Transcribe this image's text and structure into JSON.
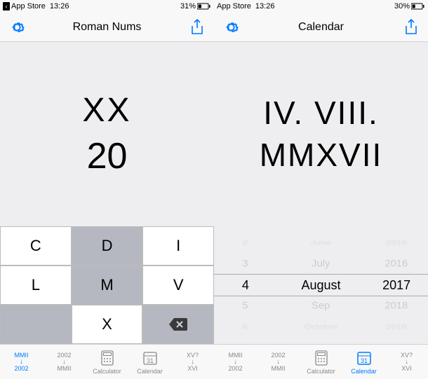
{
  "left": {
    "status": {
      "back": "‹",
      "app": "App Store",
      "time": "13:26",
      "battery": "31%"
    },
    "nav": {
      "title": "Roman Nums"
    },
    "display": {
      "roman": "XX",
      "arabic": "20"
    },
    "keyboard": {
      "rows": [
        [
          "C",
          "D",
          "I"
        ],
        [
          "L",
          "M",
          "V"
        ],
        [
          "",
          "X",
          "⌫"
        ]
      ]
    },
    "tabs": [
      {
        "top": "MMII",
        "bottom": "2002",
        "label": ""
      },
      {
        "top": "2002",
        "bottom": "MMII",
        "label": ""
      },
      {
        "label": "Calculator"
      },
      {
        "label": "Calendar"
      },
      {
        "top": "XV?",
        "bottom": "XVI",
        "label": ""
      }
    ],
    "activeTab": 0
  },
  "right": {
    "status": {
      "app": "App Store",
      "time": "13:26",
      "battery": "30%"
    },
    "nav": {
      "title": "Calendar"
    },
    "display": {
      "romanDate": "IV. VIII. MMXVII"
    },
    "picker": {
      "day": [
        "2",
        "3",
        "4",
        "5",
        "6"
      ],
      "month": [
        "June",
        "July",
        "August",
        "Sep",
        "October"
      ],
      "year": [
        "2015",
        "2016",
        "2017",
        "2018",
        "2019"
      ]
    },
    "tabs": [
      {
        "top": "MMII",
        "bottom": "2002",
        "label": ""
      },
      {
        "top": "2002",
        "bottom": "MMII",
        "label": ""
      },
      {
        "label": "Calculator"
      },
      {
        "label": "Calendar"
      },
      {
        "top": "XV?",
        "bottom": "XVI",
        "label": ""
      }
    ],
    "activeTab": 3
  },
  "colors": {
    "tint": "#007aff"
  }
}
